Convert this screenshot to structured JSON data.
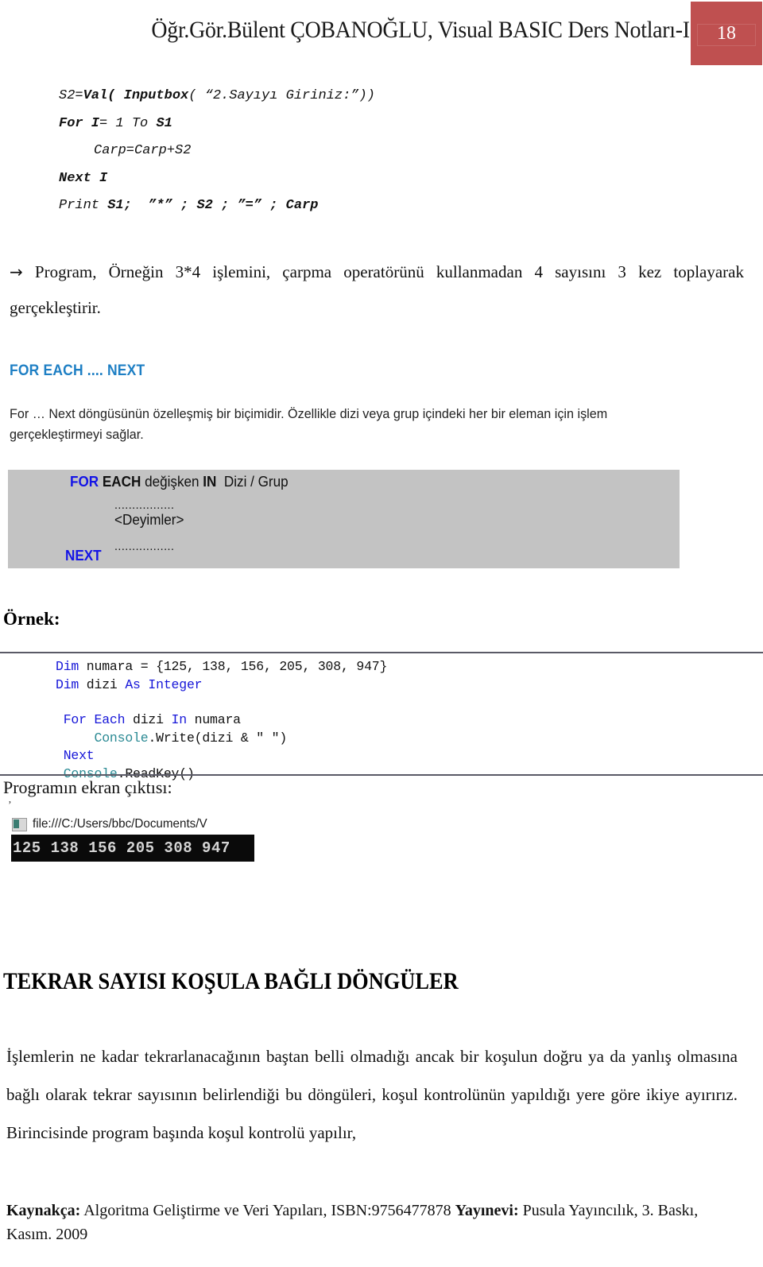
{
  "header": {
    "title": "Öğr.Gör.Bülent ÇOBANOĞLU, Visual BASIC Ders Notları-I",
    "page_number": "18",
    "badge_color": "#bf5050"
  },
  "basic_code": {
    "line1_plain": "S2=",
    "line1_bold": "Val( Inputbox",
    "line1_rest": "( “2.Sayıyı Giriniz:”))",
    "line2_bold1": "For I",
    "line2_mid": "= 1 To ",
    "line2_bold2": "S1",
    "line3": "Carp=Carp+S2",
    "line4_bold": "Next I",
    "line5_plain": "Print ",
    "line5_b1": "S1;",
    "line5_m1": "  ",
    "line5_b2": "”*” ; ",
    "line5_m2": "",
    "line5_b3": "S2 ; ”=” ; Carp"
  },
  "arrow_paragraph": {
    "arrow": "→",
    "text": "Program, Örneğin 3*4 işlemini, çarpma operatörünü kullanmadan 4 sayısını 3 kez toplayarak gerçekleştirir."
  },
  "for_each_section": {
    "heading": "FOR  EACH .... NEXT",
    "heading_color": "#1e7fc4",
    "description": "For … Next döngüsünün özelleşmiş bir biçimidir. Özellikle dizi veya grup içindeki her bir eleman için işlem gerçekleştirmeyi sağlar."
  },
  "syntax_box": {
    "background": "#c3c3c3",
    "keyword_color": "#1414e6",
    "line1_kw1": "FOR ",
    "line1_bold": "EACH",
    "line1_var": " değişken ",
    "line1_kw2": "IN",
    "line1_tail": "  Dizi / Grup",
    "dots_top": ".................",
    "statements": "<Deyimler>",
    "dots_bottom": ".................",
    "line_next": "NEXT"
  },
  "ornek": {
    "heading": "Örnek:"
  },
  "vb_code": {
    "l1_kw": "Dim",
    "l1_rest": " numara = {125, 138, 156, 205, 308, 947}",
    "l2_kw": "Dim",
    "l2_mid": " dizi ",
    "l2_kw2": "As Integer",
    "l3_kw": "For Each",
    "l3_mid": " dizi ",
    "l3_kw2": "In",
    "l3_rest": " numara",
    "l4_cls": "Console",
    "l4_rest": ".Write(dizi & \" \")",
    "l5_kw": "Next",
    "l6_cls": "Console",
    "l6_rest": ".ReadKey()"
  },
  "output": {
    "caption": "Programın ekran çıktısı:",
    "tick": "ʼ",
    "console_title": "file:///C:/Users/bbc/Documents/V",
    "console_output": "125 138 156 205 308 947"
  },
  "big_heading": {
    "text": "TEKRAR SAYISI KOŞULA BAĞLI DÖNGÜLER"
  },
  "body_paragraph": {
    "text": "İşlemlerin ne kadar tekrarlanacağının baştan belli olmadığı ancak bir koşulun doğru ya da yanlış olmasına bağlı olarak tekrar sayısının belirlendiği bu döngüleri, koşul kontrolünün yapıldığı yere göre ikiye ayırırız. Birincisinde program başında koşul kontrolü yapılır,"
  },
  "footer": {
    "label_kaynakca": "Kaynakça:",
    "source_text": " Algoritma Geliştirme ve Veri Yapıları, ISBN:9756477878 ",
    "label_yayinevi": "Yayınevi:",
    "publisher": " Pusula Yayıncılık, 3. Baskı, Kasım. 2009"
  }
}
